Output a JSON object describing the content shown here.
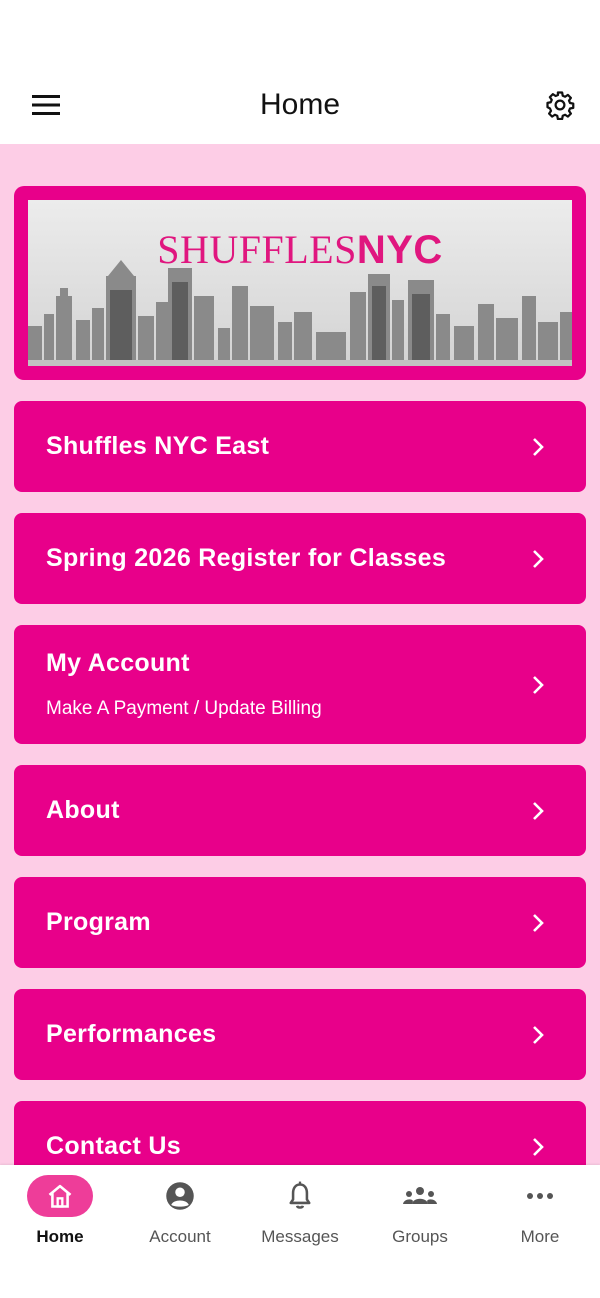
{
  "header": {
    "title": "Home",
    "menu_icon": "hamburger-menu-icon",
    "settings_icon": "gear-icon"
  },
  "banner": {
    "logo_part1": "SHUFFLES",
    "logo_part2": "NYC",
    "image": "city-skyline-image"
  },
  "menu": [
    {
      "label": "Shuffles NYC East",
      "sub": ""
    },
    {
      "label": "Spring 2026 Register for Classes",
      "sub": ""
    },
    {
      "label": "My Account",
      "sub": "Make A Payment / Update Billing"
    },
    {
      "label": "About",
      "sub": ""
    },
    {
      "label": "Program",
      "sub": ""
    },
    {
      "label": "Performances",
      "sub": ""
    },
    {
      "label": "Contact Us",
      "sub": ""
    }
  ],
  "bottom_nav": [
    {
      "label": "Home",
      "icon": "home-icon",
      "active": true
    },
    {
      "label": "Account",
      "icon": "account-icon",
      "active": false
    },
    {
      "label": "Messages",
      "icon": "bell-icon",
      "active": false
    },
    {
      "label": "Groups",
      "icon": "groups-icon",
      "active": false
    },
    {
      "label": "More",
      "icon": "more-icon",
      "active": false
    }
  ],
  "colors": {
    "accent": "#e8008a",
    "background": "#fdcde6",
    "active_pill": "#ee3d99"
  }
}
